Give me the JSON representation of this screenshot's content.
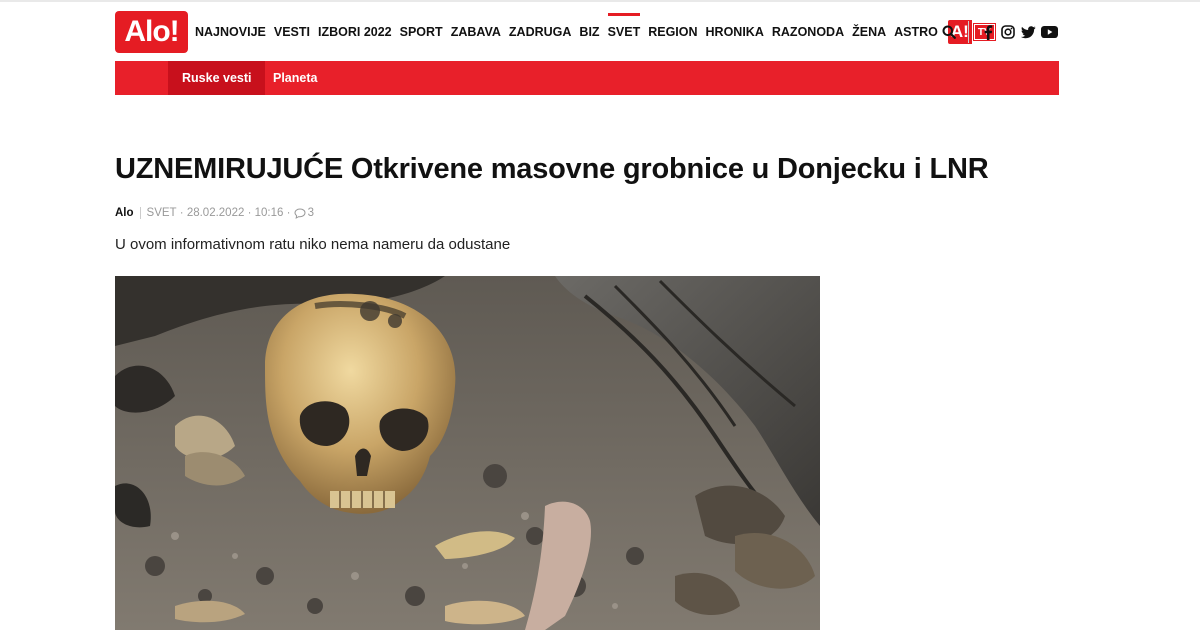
{
  "logo": {
    "text": "Alo!"
  },
  "nav": {
    "items": [
      "NAJNOVIJE",
      "VESTI",
      "IZBORI 2022",
      "SPORT",
      "ZABAVA",
      "ZADRUGA",
      "BIZ",
      "SVET",
      "REGION",
      "HRONIKA",
      "RAZONODA",
      "ŽENA",
      "ASTRO"
    ],
    "active": "SVET",
    "alo_tv": {
      "a": "A!",
      "tv": "TV"
    }
  },
  "tools": {
    "icons": [
      "search-icon",
      "facebook-icon",
      "instagram-icon",
      "twitter-icon",
      "youtube-icon"
    ]
  },
  "subnav": {
    "items": [
      {
        "label": "Ruske vesti",
        "active": true
      },
      {
        "label": "Planeta",
        "active": false
      }
    ]
  },
  "article": {
    "title": "UZNEMIRUJUĆE Otkrivene masovne grobnice u Donjecku i LNR",
    "author": "Alo",
    "category": "SVET",
    "date": "28.02.2022",
    "time": "10:16",
    "comments": "3",
    "lead": "U ovom informativnom ratu niko nema nameru da odustane"
  },
  "colors": {
    "brand_red": "#e51c23",
    "subnav_active": "#c8101c"
  }
}
